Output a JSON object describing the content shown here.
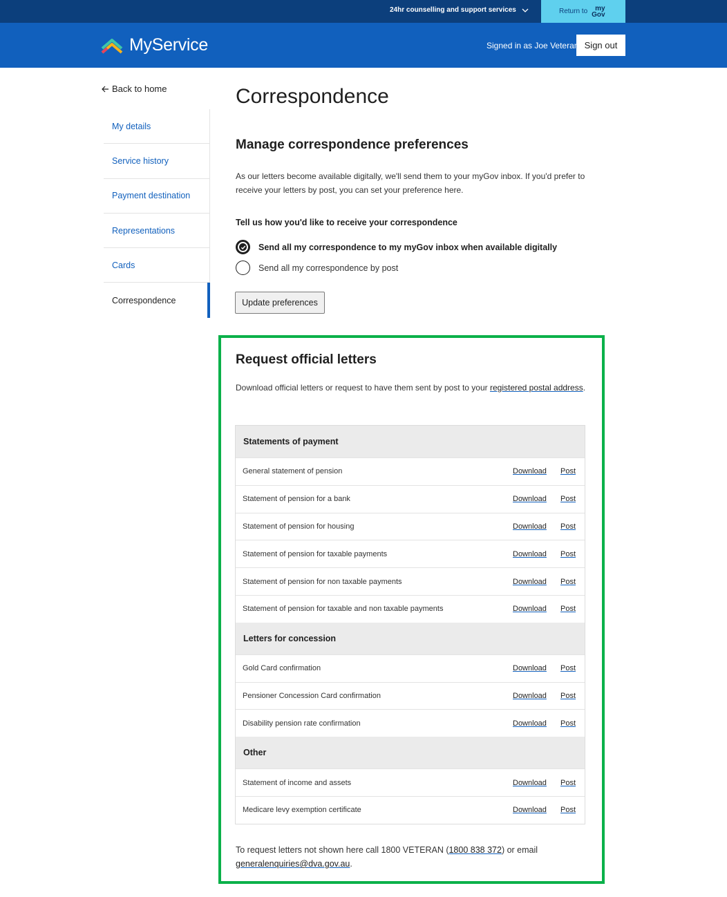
{
  "topbar": {
    "support_label": "24hr counselling and support services",
    "return_label": "Return to",
    "mygov_logo_top": "my",
    "mygov_logo_bottom": "Gov"
  },
  "header": {
    "brand": "MyService",
    "signed_in": "Signed in as Joe Veteran",
    "signout": "Sign out"
  },
  "sidebar": {
    "back": "Back to home",
    "items": [
      {
        "label": "My details"
      },
      {
        "label": "Service history"
      },
      {
        "label": "Payment destination"
      },
      {
        "label": "Representations"
      },
      {
        "label": "Cards"
      },
      {
        "label": "Correspondence",
        "active": true
      }
    ]
  },
  "main": {
    "title": "Correspondence",
    "section_title": "Manage correspondence preferences",
    "intro": "As our letters become available digitally, we'll send them to your myGov inbox. If you'd prefer to receive your letters by post, you can set your preference here.",
    "question": "Tell us how you'd like to receive your correspondence",
    "options": [
      {
        "label": "Send all my correspondence to my myGov inbox when available digitally",
        "selected": true
      },
      {
        "label": "Send all my correspondence by post",
        "selected": false
      }
    ],
    "update_button": "Update preferences"
  },
  "letters": {
    "title": "Request official letters",
    "desc_prefix": "Download official letters or request to have them sent by post to your ",
    "desc_link": "registered postal address",
    "desc_suffix": ".",
    "download_label": "Download",
    "post_label": "Post",
    "groups": [
      {
        "name": "Statements of payment",
        "rows": [
          "General statement of pension",
          "Statement of pension for a bank",
          "Statement of pension for housing",
          "Statement of pension for taxable payments",
          "Statement of pension for non taxable payments",
          "Statement of pension for taxable and non taxable payments"
        ]
      },
      {
        "name": "Letters for concession",
        "rows": [
          "Gold Card confirmation",
          "Pensioner Concession Card confirmation",
          "Disability pension rate confirmation"
        ]
      },
      {
        "name": "Other",
        "rows": [
          "Statement of income and assets",
          "Medicare levy exemption certificate"
        ]
      }
    ],
    "footer_prefix": "To request letters not shown here call 1800 VETERAN (",
    "footer_phone": "1800 838 372",
    "footer_mid": ") or email",
    "footer_email": "generalenquiries@dva.gov.au",
    "footer_suffix": "."
  },
  "colors": {
    "topbar": "#0c3f7c",
    "header": "#1160bd",
    "mygov_button": "#5fd0ee",
    "highlight_border": "#0bb14a"
  }
}
